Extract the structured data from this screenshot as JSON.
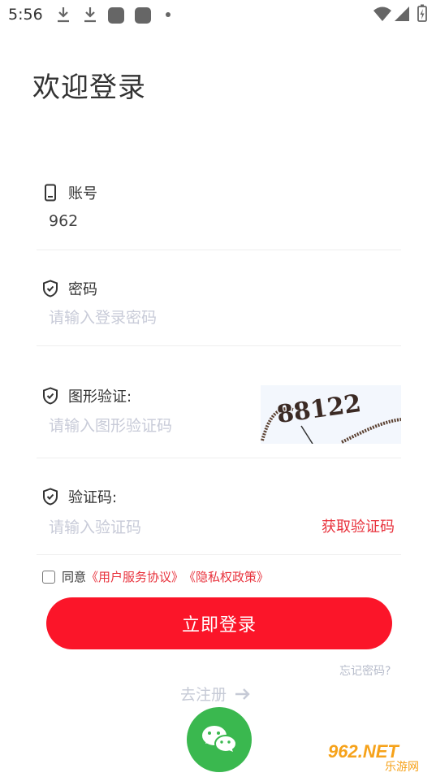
{
  "status_bar": {
    "time": "5:56"
  },
  "page": {
    "title": "欢迎登录"
  },
  "account": {
    "label": "账号",
    "value": "962"
  },
  "password": {
    "label": "密码",
    "placeholder": "请输入登录密码"
  },
  "captcha": {
    "label": "图形验证:",
    "placeholder": "请输入图形验证码",
    "image_text": "88122"
  },
  "sms": {
    "label": "验证码:",
    "placeholder": "请输入验证码",
    "get_code": "获取验证码"
  },
  "agreement": {
    "prefix": "同意",
    "user_agreement": "《用户服务协议》",
    "privacy_policy": "《隐私权政策》"
  },
  "login_button": "立即登录",
  "forgot_password": "忘记密码?",
  "register": "去注册",
  "watermark": {
    "top": "962.NET",
    "bottom": "乐游网"
  },
  "colors": {
    "accent": "#fb1529",
    "link": "#e8323c",
    "wechat": "#3ab84f"
  }
}
